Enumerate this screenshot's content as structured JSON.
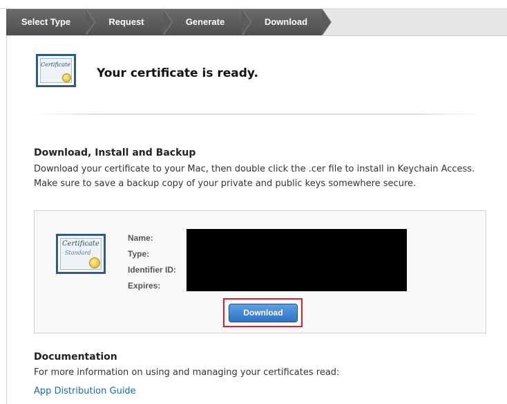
{
  "wizard": {
    "steps": [
      {
        "label": "Select Type"
      },
      {
        "label": "Request"
      },
      {
        "label": "Generate"
      },
      {
        "label": "Download"
      }
    ]
  },
  "header": {
    "title": "Your certificate is ready.",
    "icon_text": "Certificate"
  },
  "install_section": {
    "heading": "Download, Install and Backup",
    "description": "Download your certificate to your Mac, then double click the .cer file to install in Keychain Access. Make sure to save a backup copy of your private and public keys somewhere secure."
  },
  "certificate": {
    "icon_text": "Certificate",
    "icon_subtext": "Standard",
    "fields": [
      {
        "label": "Name:"
      },
      {
        "label": "Type:"
      },
      {
        "label": "Identifier ID:"
      },
      {
        "label": "Expires:"
      }
    ],
    "download_label": "Download"
  },
  "documentation": {
    "heading": "Documentation",
    "description": "For more information on using and managing your certificates read:",
    "link_text": "App Distribution Guide"
  },
  "colors": {
    "accent_button": "#2f71c4",
    "highlight_border": "#d2232a",
    "link": "#1a66c2"
  }
}
